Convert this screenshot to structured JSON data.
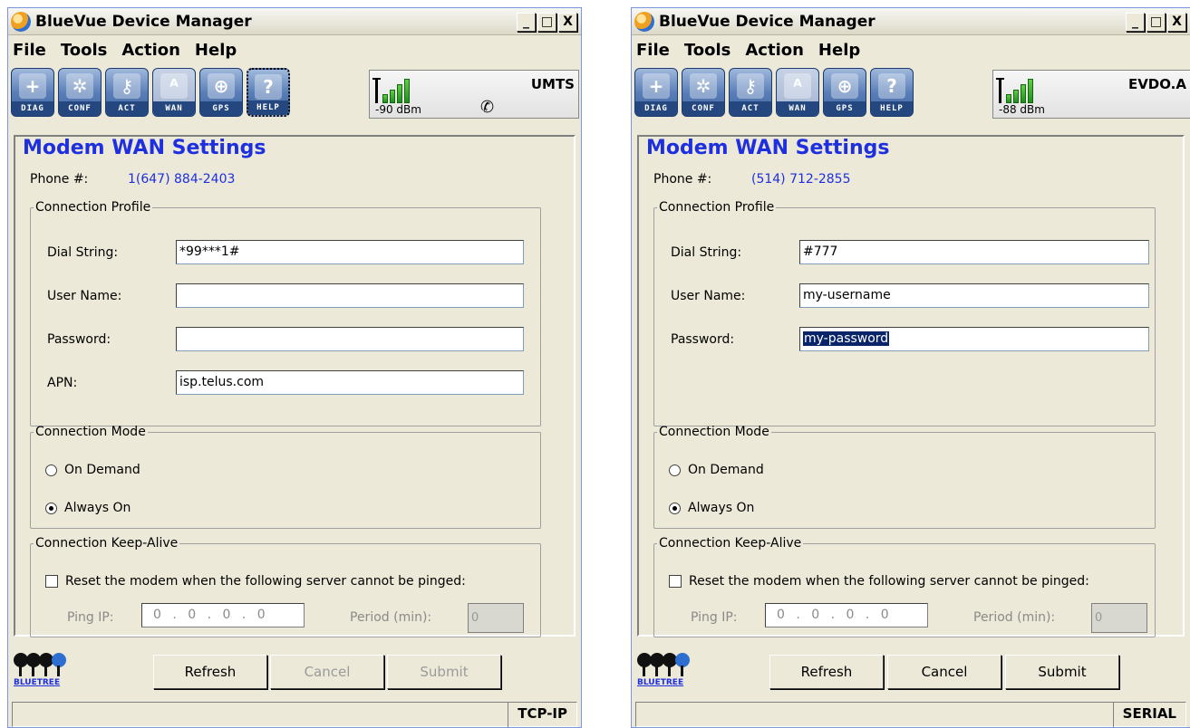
{
  "app_title": "BlueVue Device Manager",
  "window_buttons": [
    "_",
    "□",
    "X"
  ],
  "menu": [
    "File",
    "Tools",
    "Action",
    "Help"
  ],
  "toolbar": [
    {
      "label": "DIAG",
      "glyph": "+",
      "icon": "diag-icon"
    },
    {
      "label": "CONF",
      "glyph": "✲",
      "icon": "gear-icon"
    },
    {
      "label": "ACT",
      "glyph": "⚷",
      "icon": "key-icon"
    },
    {
      "label": "WAN",
      "glyph": "ᴬ",
      "icon": "antenna-icon"
    },
    {
      "label": "GPS",
      "glyph": "⊕",
      "icon": "globe-icon"
    },
    {
      "label": "HELP",
      "glyph": "?",
      "icon": "help-icon"
    }
  ],
  "heading": "Modem WAN Settings",
  "phone_label": "Phone #:",
  "profile_legend": "Connection Profile",
  "mode_legend": "Connection Mode",
  "keepalive_legend": "Connection Keep-Alive",
  "labels": {
    "dial": "Dial String:",
    "user": "User Name:",
    "password": "Password:",
    "apn": "APN:",
    "on_demand": "On Demand",
    "always_on": "Always On",
    "reset": "Reset the modem when the following server cannot be pinged:",
    "ping_ip": "Ping IP:",
    "period": "Period (min):"
  },
  "buttons": {
    "refresh": "Refresh",
    "cancel": "Cancel",
    "submit": "Submit"
  },
  "logo_text": "BLUETREE",
  "left": {
    "signal": "-90 dBm",
    "network": "UMTS",
    "phone": "1(647) 884-2403",
    "dial": "*99***1#",
    "user": "",
    "password": "",
    "apn": "isp.telus.com",
    "mode": "always_on",
    "ping_ip": "0 . 0 . 0 . 0",
    "period": "0",
    "status": "TCP-IP"
  },
  "right": {
    "signal": "-88 dBm",
    "network": "EVDO.A",
    "phone": "(514) 712-2855",
    "dial": "#777",
    "user": "my-username",
    "password": "my-password",
    "mode": "always_on",
    "ping_ip": "0 . 0 . 0 . 0",
    "period": "0",
    "status": "SERIAL"
  }
}
